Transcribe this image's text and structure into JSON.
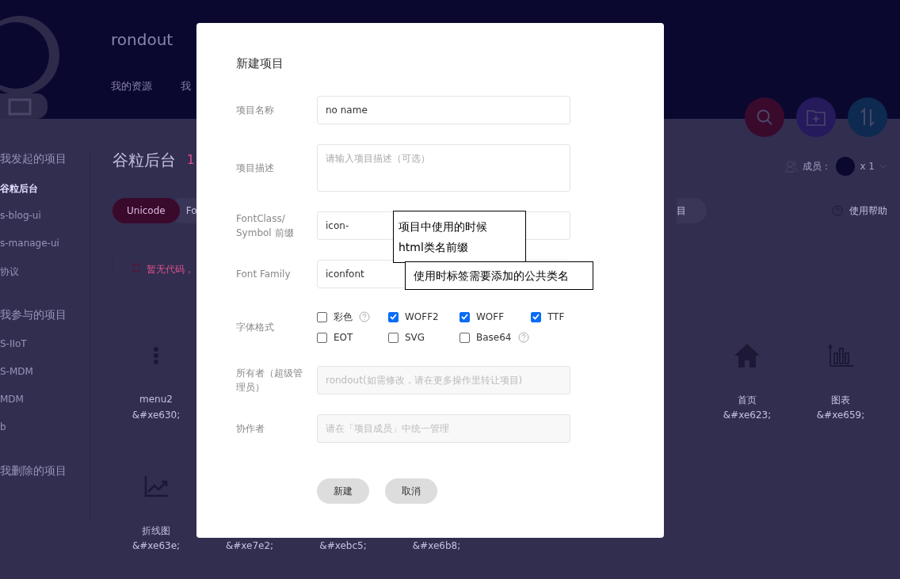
{
  "header": {
    "brand": "rondout",
    "nav": [
      {
        "label": "我的资源"
      },
      {
        "label": "我"
      }
    ],
    "actions": [
      {
        "kind": "search"
      },
      {
        "kind": "folder-add"
      },
      {
        "kind": "sort"
      }
    ]
  },
  "sidebar": {
    "sections": [
      {
        "title": "我发起的项目",
        "items": [
          {
            "label": "谷粒后台",
            "selected": true
          },
          {
            "label": "s-blog-ui",
            "selected": false
          },
          {
            "label": "s-manage-ui",
            "selected": false
          },
          {
            "label": "协议",
            "selected": false
          }
        ]
      },
      {
        "title": "我参与的项目",
        "items": [
          {
            "label": "S-IIoT",
            "selected": false
          },
          {
            "label": "S-MDM",
            "selected": false
          },
          {
            "label": "MDM",
            "selected": false
          },
          {
            "label": "b",
            "selected": false
          }
        ]
      },
      {
        "title": "我删除的项目"
      }
    ]
  },
  "project": {
    "title": "谷粒后台",
    "count": "1",
    "members_label": "成员：",
    "members_count": "x 1",
    "tabs": [
      {
        "label": "Unicode",
        "selected": true
      },
      {
        "label": "Fo",
        "selected": false
      }
    ],
    "tab_right": "目",
    "help": "使用帮助",
    "notice": "暂无代码，",
    "icon_rows": [
      [
        {
          "kind": "dots",
          "name": "menu2",
          "code": "&#xe630;"
        },
        {
          "kind": "house",
          "name": "首页",
          "code": "&#xe623;"
        },
        {
          "kind": "bars",
          "name": "图表",
          "code": "&#xe659;"
        }
      ],
      [
        {
          "kind": "line",
          "name": "折线图",
          "code": "&#xe63e;"
        },
        {
          "code": "&#xe7e2;"
        },
        {
          "code": "&#xebc5;"
        },
        {
          "code": "&#xe6b8;"
        }
      ]
    ]
  },
  "dialog": {
    "title": "新建项目",
    "fields": [
      {
        "label": "项目名称",
        "kind": "input",
        "value": "no name"
      },
      {
        "label": "项目描述",
        "kind": "textarea",
        "placeholder": "请输入项目描述（可选）"
      },
      {
        "label": "FontClass/ Symbol 前缀",
        "kind": "input",
        "value": "icon-"
      },
      {
        "label": "Font Family",
        "kind": "input",
        "value": "iconfont"
      },
      {
        "label": "字体格式",
        "kind": "checkboxes",
        "options": [
          {
            "label": "彩色",
            "checked": false,
            "help": true
          },
          {
            "label": "WOFF2",
            "checked": true
          },
          {
            "label": "WOFF",
            "checked": true
          },
          {
            "label": "TTF",
            "checked": true
          },
          {
            "label": "EOT",
            "checked": false
          },
          {
            "label": "SVG",
            "checked": false
          },
          {
            "label": "Base64",
            "checked": false,
            "help": true
          }
        ]
      },
      {
        "label": "所有者（超级管理员）",
        "kind": "disabled",
        "placeholder": "rondout(如需修改，请在更多操作里转让项目)"
      },
      {
        "label": "协作者",
        "kind": "disabled",
        "placeholder": "请在「项目成员」中统一管理"
      }
    ],
    "buttons": [
      "新建",
      "取消"
    ],
    "notes": [
      {
        "lines": [
          "项目中使用的时候",
          "html类名前缀"
        ]
      },
      {
        "lines": [
          "使用时标签需要添加的公共类名"
        ]
      }
    ]
  }
}
